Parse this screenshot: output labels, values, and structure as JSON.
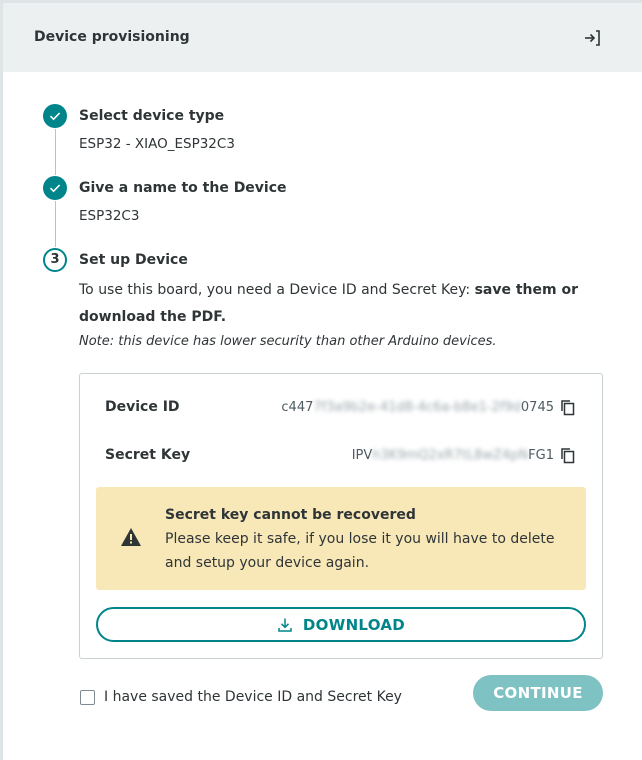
{
  "header": {
    "title": "Device provisioning",
    "exit_icon": "exit-to-right-icon"
  },
  "steps": [
    {
      "index": 1,
      "state": "done",
      "title": "Select device type",
      "value": "ESP32 - XIAO_ESP32C3"
    },
    {
      "index": 2,
      "state": "done",
      "title": "Give a name to the Device",
      "value": "ESP32C3"
    },
    {
      "index": 3,
      "state": "current",
      "number": "3",
      "title": "Set up Device"
    }
  ],
  "setup": {
    "description_plain": "To use this board, you need a Device ID and Secret Key: ",
    "description_bold": "save them or download the PDF.",
    "note": "Note: this device has lower security than other Arduino devices."
  },
  "credentials": {
    "device_id": {
      "label": "Device ID",
      "prefix": "c447",
      "masked": "7f3a9b2e-41d8-4c6a-b8e1-2f9d",
      "suffix": "0745"
    },
    "secret_key": {
      "label": "Secret Key",
      "prefix": "IPV",
      "masked": "h3K9mQ2xR7tL8wZ4pN",
      "suffix": "FG1"
    }
  },
  "warning": {
    "title": "Secret key cannot be recovered",
    "text": "Please keep it safe, if you lose it you will have to delete and setup your device again."
  },
  "download": {
    "label": "DOWNLOAD"
  },
  "confirm": {
    "label": "I have saved the Device ID and Secret Key",
    "checked": false
  },
  "continue": {
    "label": "CONTINUE",
    "enabled": false
  },
  "colors": {
    "accent": "#00858a",
    "accent_disabled": "#7fc2c4",
    "warning_bg": "#f8e8b8",
    "header_bg": "#ecf0f1"
  }
}
